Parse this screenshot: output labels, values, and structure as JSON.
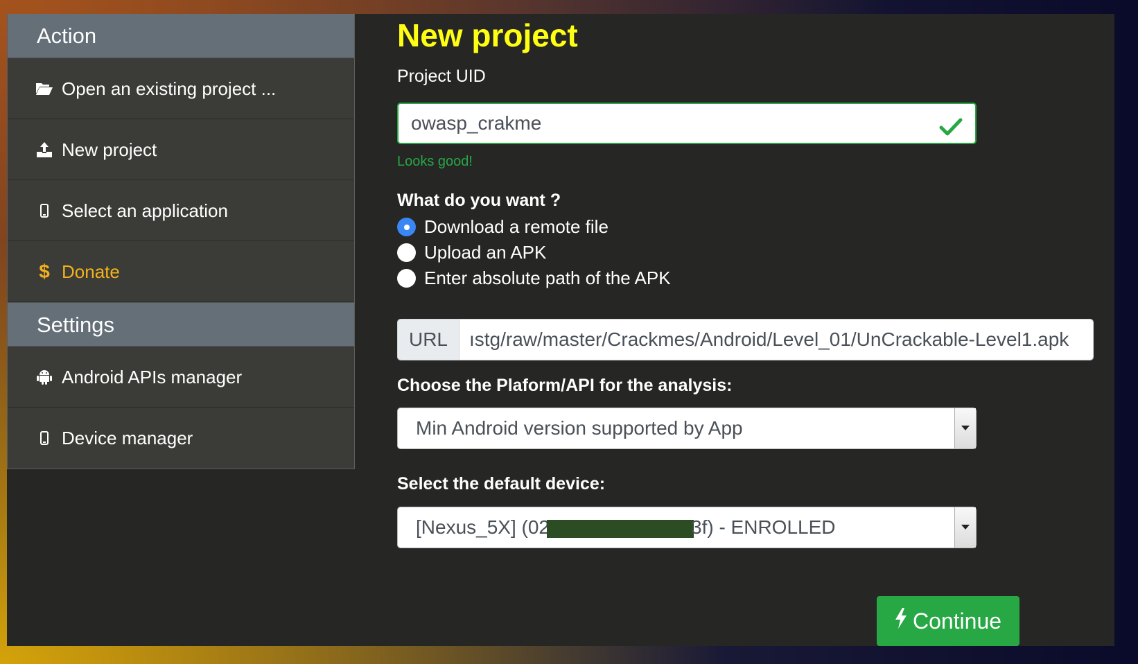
{
  "sidebar": {
    "action_header": "Action",
    "settings_header": "Settings",
    "items": {
      "open_project": "Open an existing project ...",
      "new_project": "New project",
      "select_app": "Select an application",
      "donate": "Donate",
      "android_apis": "Android APIs manager",
      "device_manager": "Device manager"
    }
  },
  "main": {
    "title": "New project",
    "uid_label": "Project UID",
    "uid_value": "owasp_crakme",
    "uid_feedback": "Looks good!",
    "want_label": "What do you want ?",
    "options": {
      "download": "Download a remote file",
      "upload": "Upload an APK",
      "path": "Enter absolute path of the APK"
    },
    "selected_option": "download",
    "url_prefix": "URL",
    "url_value": "ıstg/raw/master/Crackmes/Android/Level_01/UnCrackable-Level1.apk",
    "platform_label": "Choose the Plaform/API for the analysis:",
    "platform_value": "Min Android version supported by App",
    "device_label": "Select the default device:",
    "device_value_prefix": "[Nexus_5X] (02",
    "device_value_suffix": "3f) - ENROLLED",
    "continue_label": "Continue"
  },
  "colors": {
    "title": "#ffff14",
    "accent_green": "#28a745",
    "donate": "#f3b21c",
    "radio_checked": "#3a86f5"
  }
}
